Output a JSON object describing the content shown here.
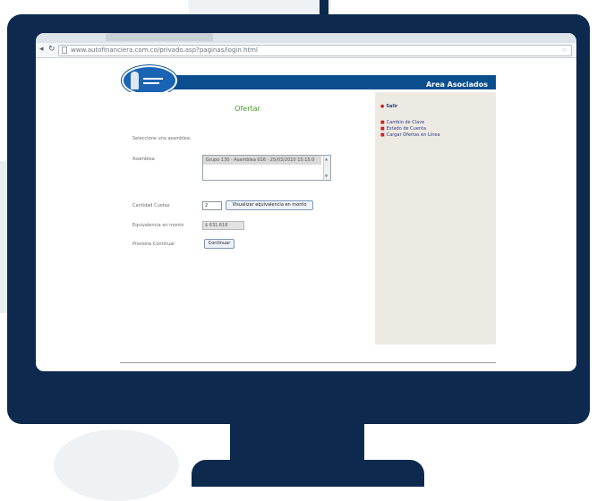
{
  "browser": {
    "url": "www.autofinanciera.com.co/privado.asp?paginas/login.html",
    "icons": {
      "back": "back-arrow-icon",
      "reload": "reload-icon",
      "page": "page-icon",
      "star": "star-icon"
    }
  },
  "header": {
    "title": "Area Asociados"
  },
  "form": {
    "title": "Ofertar",
    "instruction": "Seleccione una asamblea:",
    "assembly_label": "Asamblea",
    "assembly_option": "Grupo 130 · Asamblea 016 · 25/03/2010 15:15:0",
    "quotas_label": "Cantidad Cuotas",
    "quotas_value": "2",
    "visualize_button": "Visualizar equivalencia en monto",
    "equivalence_label": "Equivalencia en monto",
    "equivalence_value": "$ 631.618",
    "continue_label": "Presione Continuar",
    "continue_button": "Continuar"
  },
  "sidebar": {
    "exit": "Salir",
    "links": [
      "Cambio de Clave",
      "Estado de Cuenta",
      "Cargar Ofertas en Línea"
    ]
  },
  "colors": {
    "monitor": "#0d2a4e",
    "header_bar": "#0a4e8e",
    "title_green": "#4e9a2a",
    "sidebar_bg": "#edeae3",
    "bullet_red": "#cc2222"
  }
}
